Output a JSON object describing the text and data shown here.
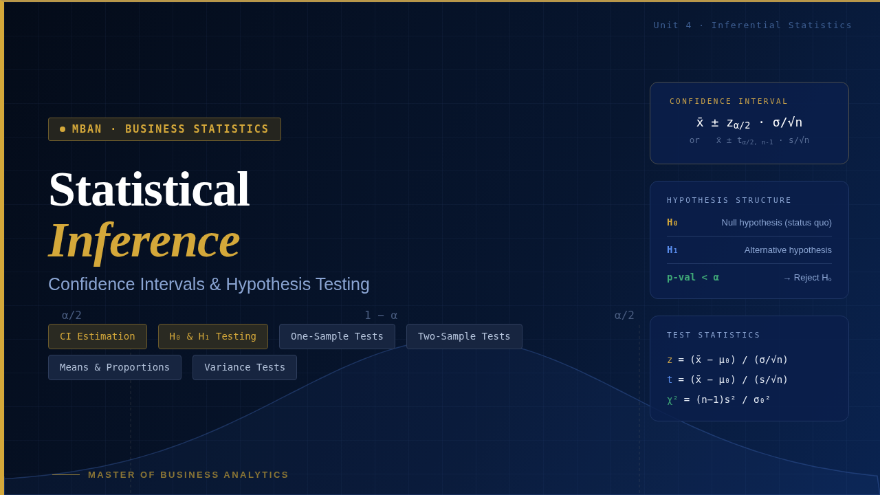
{
  "unit_label": "Unit 4 · Inferential Statistics",
  "background_curve": {
    "labels": [
      "α/2",
      "1 − α",
      "α/2"
    ]
  },
  "badge": {
    "text": "MBAN · BUSINESS STATISTICS"
  },
  "title": {
    "line_1": "Statistical",
    "line_2": "Inference"
  },
  "subtitle": "Confidence Intervals & Hypothesis Testing",
  "tags": [
    {
      "label": "CI Estimation",
      "highlighted": true
    },
    {
      "label": "H₀ & H₁ Testing",
      "highlighted": true
    },
    {
      "label": "One-Sample Tests",
      "highlighted": false
    },
    {
      "label": "Two-Sample Tests",
      "highlighted": false
    },
    {
      "label": "Means & Proportions",
      "highlighted": false
    },
    {
      "label": "Variance Tests",
      "highlighted": false
    }
  ],
  "footer": "MASTER OF BUSINESS ANALYTICS",
  "cards": [
    {
      "kind": "formula",
      "title": "CONFIDENCE INTERVAL",
      "formula": "x̄ ± z$_{α/2}$ · σ/√n",
      "alternative_prefix": "or",
      "alternative": "x̄ ± t$_{α/2, n-1}$ · s/√n"
    },
    {
      "kind": "rows",
      "title": "HYPOTHESIS STRUCTURE",
      "rows": [
        {
          "symbol": "H₀",
          "text": "Null hypothesis (status quo)",
          "color": "#d4a83a"
        },
        {
          "symbol": "H₁",
          "text": "Alternative hypothesis",
          "color": "#5b8ff0"
        },
        {
          "symbol": "p-val < α",
          "text": "→ Reject H₀",
          "color": "#3fa877"
        }
      ]
    },
    {
      "kind": "equations",
      "title": "TEST STATISTICS",
      "equations": [
        {
          "variable": "z",
          "rest": "= (x̄ − μ₀) / (σ/√n)",
          "color": "#c9a24a"
        },
        {
          "variable": "t",
          "rest": "= (x̄ − μ₀) / (s/√n)",
          "color": "#5b8ff0"
        },
        {
          "variable": "χ²",
          "rest": "= (n−1)s² / σ₀²",
          "color": "#3fa877"
        }
      ]
    }
  ]
}
